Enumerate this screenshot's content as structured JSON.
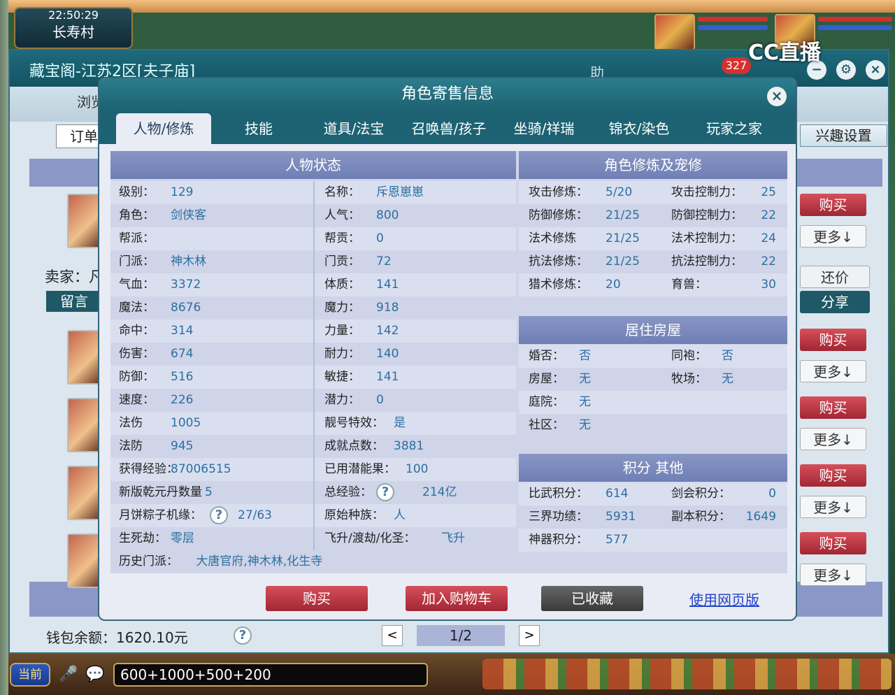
{
  "game": {
    "clock": "22:50:29",
    "location": "长寿村",
    "streamer_logo": "CC直播",
    "badge_count": "327"
  },
  "window": {
    "title": "藏宝阁-江苏2区[夫子庙]",
    "header_icons": [
      "助"
    ],
    "left_tabs": [
      "浏览",
      "订单"
    ],
    "interest_btn": "兴趣设置",
    "seller_label": "卖家：凡",
    "message_btn": "留言"
  },
  "side_buttons": {
    "buy": "购买",
    "more": "更多↓",
    "bargain": "还价",
    "share": "分享"
  },
  "dialog": {
    "title": "角色寄售信息",
    "close": "×",
    "tabs": [
      "人物/修炼",
      "技能",
      "道具/法宝",
      "召唤兽/孩子",
      "坐骑/祥瑞",
      "锦衣/染色",
      "玩家之家"
    ],
    "status_title": "人物状态",
    "status_left": [
      {
        "k": "级别：",
        "v": "129"
      },
      {
        "k": "角色：",
        "v": "剑侠客"
      },
      {
        "k": "帮派：",
        "v": ""
      },
      {
        "k": "门派：",
        "v": "神木林"
      },
      {
        "k": "气血：",
        "v": "3372"
      },
      {
        "k": "魔法：",
        "v": "8676"
      },
      {
        "k": "命中：",
        "v": "314"
      },
      {
        "k": "伤害：",
        "v": "674"
      },
      {
        "k": "防御：",
        "v": "516"
      },
      {
        "k": "速度：",
        "v": "226"
      },
      {
        "k": "法伤",
        "v": "1005"
      },
      {
        "k": "法防",
        "v": "945"
      },
      {
        "k": "获得经验：",
        "v": "87006515"
      },
      {
        "k": "新版乾元丹数量",
        "v": "5"
      },
      {
        "k": "月饼粽子机缘：",
        "v": "27/63"
      },
      {
        "k": "生死劫：",
        "v": "零层"
      }
    ],
    "status_right": [
      {
        "k": "名称：",
        "v": "斥恩崽崽"
      },
      {
        "k": "人气：",
        "v": "800"
      },
      {
        "k": "帮贡：",
        "v": "0"
      },
      {
        "k": "门贡：",
        "v": "72"
      },
      {
        "k": "体质：",
        "v": "141"
      },
      {
        "k": "魔力：",
        "v": "918"
      },
      {
        "k": "力量：",
        "v": "142"
      },
      {
        "k": "耐力：",
        "v": "140"
      },
      {
        "k": "敏捷：",
        "v": "141"
      },
      {
        "k": "潜力：",
        "v": "0"
      },
      {
        "k": "靓号特效：",
        "v": "是"
      },
      {
        "k": "成就点数：",
        "v": "3881"
      },
      {
        "k": "已用潜能果：",
        "v": "100"
      },
      {
        "k": "总经验：",
        "v": "214亿"
      },
      {
        "k": "原始种族：",
        "v": "人"
      },
      {
        "k": "飞升/渡劫/化圣：",
        "v": "飞升"
      }
    ],
    "history_label": "历史门派：",
    "history_value": "大唐官府,神木林,化生寺",
    "cult_title": "角色修炼及宠修",
    "cult": [
      {
        "k1": "攻击修炼：",
        "v1": "5/20",
        "k2": "攻击控制力：",
        "v2": "25"
      },
      {
        "k1": "防御修炼：",
        "v1": "21/25",
        "k2": "防御控制力：",
        "v2": "22"
      },
      {
        "k1": "法术修炼",
        "v1": "21/25",
        "k2": "法术控制力：",
        "v2": "24"
      },
      {
        "k1": "抗法修炼：",
        "v1": "21/25",
        "k2": "抗法控制力：",
        "v2": "22"
      },
      {
        "k1": "猎术修炼：",
        "v1": "20",
        "k2": "育兽：",
        "v2": "30"
      }
    ],
    "house_title": "居住房屋",
    "house": [
      {
        "k1": "婚否：",
        "v1": "否",
        "k2": "同袍：",
        "v2": "否"
      },
      {
        "k1": "房屋：",
        "v1": "无",
        "k2": "牧场：",
        "v2": "无"
      },
      {
        "k1": "庭院：",
        "v1": "无",
        "k2": "",
        "v2": ""
      },
      {
        "k1": "社区：",
        "v1": "无",
        "k2": "",
        "v2": ""
      }
    ],
    "score_title": "积分 其他",
    "score": [
      {
        "k1": "比武积分：",
        "v1": "614",
        "k2": "剑会积分：",
        "v2": "0"
      },
      {
        "k1": "三界功绩：",
        "v1": "5931",
        "k2": "副本积分：",
        "v2": "1649"
      },
      {
        "k1": "神器积分：",
        "v1": "577",
        "k2": "",
        "v2": ""
      }
    ],
    "buy_btn": "购买",
    "cart_btn": "加入购物车",
    "fav_btn": "已收藏",
    "web_link": "使用网页版"
  },
  "footer": {
    "wallet": "钱包余额：1620.10元",
    "page": "1/2",
    "prev": "<",
    "next": ">"
  },
  "chat": {
    "channel": "当前",
    "input_value": "600+1000+500+200"
  }
}
